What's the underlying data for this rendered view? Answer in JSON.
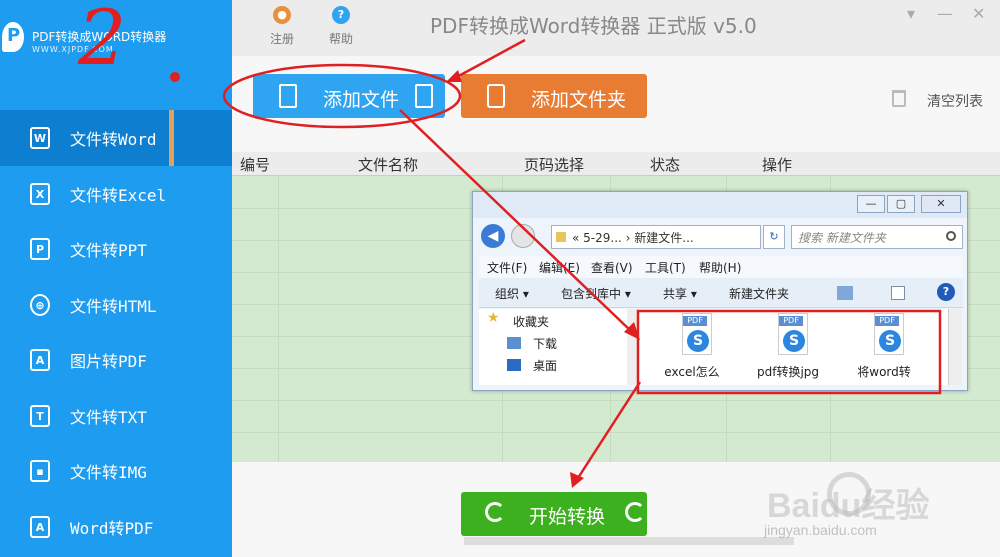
{
  "app": {
    "title": "PDF转换成Word转换器 正式版 v5.0",
    "logo_title": "PDF转换成WORD转换器",
    "logo_sub": "WWW.XJPDF.COM"
  },
  "topbar": {
    "register_label": "注册",
    "help_label": "帮助"
  },
  "sidebar": {
    "items": [
      {
        "label": "文件转Word",
        "icon": "word-file-icon",
        "glyph": "W"
      },
      {
        "label": "文件转Excel",
        "icon": "excel-file-icon",
        "glyph": "X"
      },
      {
        "label": "文件转PPT",
        "icon": "ppt-file-icon",
        "glyph": "P"
      },
      {
        "label": "文件转HTML",
        "icon": "globe-icon",
        "glyph": "⊕"
      },
      {
        "label": "图片转PDF",
        "icon": "pdf-file-icon",
        "glyph": "A"
      },
      {
        "label": "文件转TXT",
        "icon": "txt-file-icon",
        "glyph": "T"
      },
      {
        "label": "文件转IMG",
        "icon": "image-file-icon",
        "glyph": "▪"
      },
      {
        "label": "Word转PDF",
        "icon": "pdf-file-icon",
        "glyph": "A"
      }
    ]
  },
  "toolbar": {
    "add_file_label": "添加文件",
    "add_folder_label": "添加文件夹",
    "clear_list_label": "清空列表"
  },
  "table": {
    "headers": [
      "编号",
      "文件名称",
      "页码选择",
      "状态",
      "操作"
    ]
  },
  "bottom": {
    "start_label": "开始转换",
    "watermark": "Baidu经验",
    "watermark_sub": "jingyan.baidu.com"
  },
  "explorer": {
    "address": "« 5-29... › 新建文件...",
    "search_placeholder": "搜索 新建文件夹",
    "menu": [
      "文件(F)",
      "编辑(E)",
      "查看(V)",
      "工具(T)",
      "帮助(H)"
    ],
    "commands": [
      "组织 ▾",
      "包含到库中 ▾",
      "共享 ▾",
      "新建文件夹"
    ],
    "nav": [
      "收藏夹",
      "下载",
      "桌面"
    ],
    "files": [
      {
        "name": "excel怎么",
        "tag": "PDF"
      },
      {
        "name": "pdf转换jpg",
        "tag": "PDF"
      },
      {
        "name": "将word转",
        "tag": "PDF"
      }
    ]
  },
  "annotation": {
    "step_number": "2",
    "color": "#e02020"
  },
  "colors": {
    "sidebar": "#1e9cf0",
    "add_file": "#2fa5f2",
    "add_folder": "#e87c33",
    "start": "#3cb01e",
    "table_bg": "#d4ead0"
  }
}
